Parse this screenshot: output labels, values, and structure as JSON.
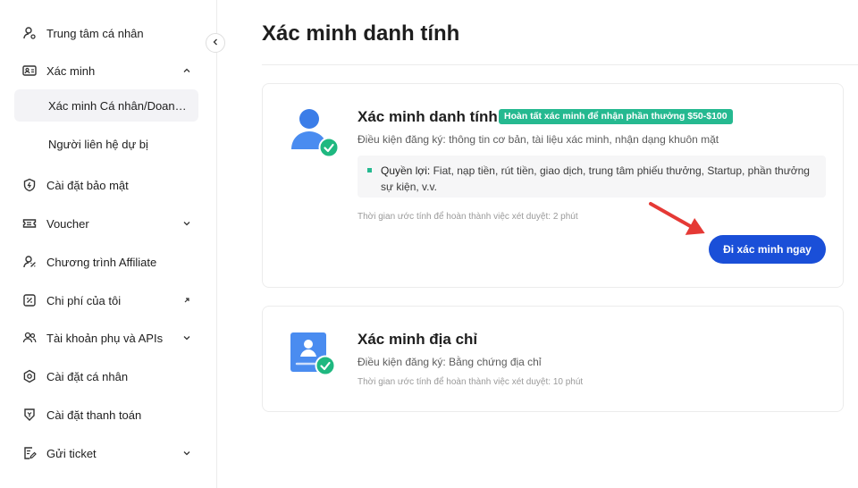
{
  "sidebar": {
    "items": [
      {
        "label": "Trung tâm cá nhân"
      },
      {
        "label": "Xác minh"
      },
      {
        "label": "Cài đặt bảo mật"
      },
      {
        "label": "Voucher"
      },
      {
        "label": "Chương trình Affiliate"
      },
      {
        "label": "Chi phí của tôi"
      },
      {
        "label": "Tài khoản phụ và APIs"
      },
      {
        "label": "Cài đặt cá nhân"
      },
      {
        "label": "Cài đặt thanh toán"
      },
      {
        "label": "Gửi ticket"
      }
    ],
    "sub_items": [
      {
        "label": "Xác minh Cá nhân/Doanh nghiệp",
        "active": true
      },
      {
        "label": "Người liên hệ dự bị",
        "active": false
      }
    ]
  },
  "main": {
    "title": "Xác minh danh tính",
    "identity_card": {
      "title": "Xác minh danh tính",
      "badge": "Hoàn tất xác minh để nhận phần thưởng $50-$100",
      "conditions_label": "Điều kiện đăng ký:",
      "conditions": "thông tin cơ bản, tài liệu xác minh, nhận dạng khuôn mặt",
      "benefits_label": "Quyền lợi:",
      "benefits": "Fiat, nạp tiền, rút tiền, giao dịch, trung tâm phiếu thưởng, Startup, phần thưởng sự kiện, v.v.",
      "time": "Thời gian ước tính để hoàn thành việc xét duyệt: 2 phút",
      "button": "Đi xác minh ngay"
    },
    "address_card": {
      "title": "Xác minh địa chỉ",
      "conditions_label": "Điều kiện đăng ký:",
      "conditions": "Bằng chứng địa chỉ",
      "time": "Thời gian ước tính để hoàn thành việc xét duyệt: 10 phút"
    }
  },
  "colors": {
    "accent_blue": "#1a4fd8",
    "accent_green": "#25b990",
    "arrow_red": "#e53935"
  }
}
